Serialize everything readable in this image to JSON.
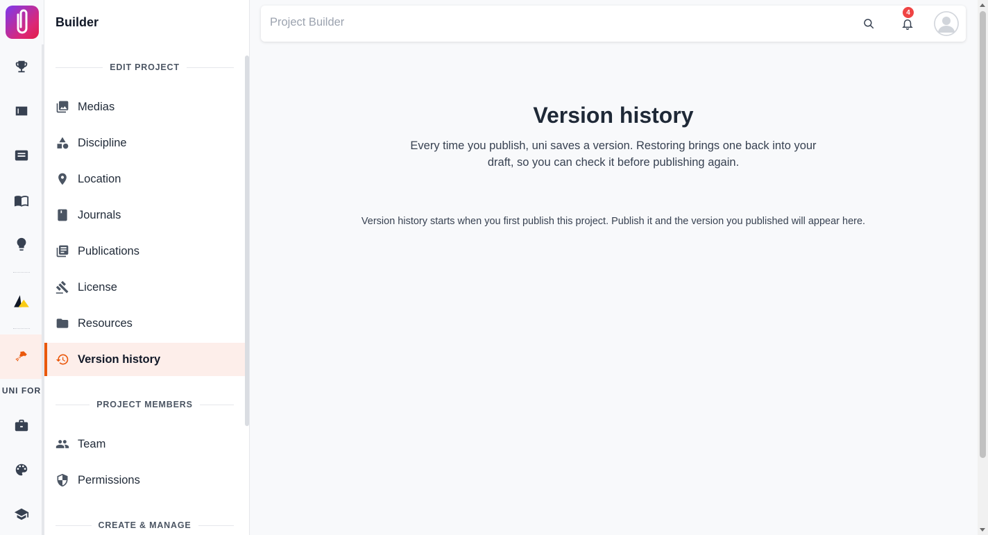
{
  "app": {
    "brand_color": "#db2777",
    "accent": "#ea580c"
  },
  "rail": {
    "items": [
      {
        "name": "trophy-icon"
      },
      {
        "name": "hashtag-card-icon"
      },
      {
        "name": "article-icon"
      },
      {
        "name": "book-icon"
      },
      {
        "name": "lightbulb-icon"
      },
      {
        "name": "shapes-icon"
      },
      {
        "name": "pen-tool-icon",
        "active": true
      },
      {
        "name": "briefcase-icon"
      },
      {
        "name": "palette-icon"
      },
      {
        "name": "graduation-cap-icon"
      }
    ],
    "section_label": "UNI FOR"
  },
  "sidebar": {
    "title": "Builder",
    "section_edit": "EDIT PROJECT",
    "section_members": "PROJECT MEMBERS",
    "section_create": "CREATE & MANAGE",
    "items": [
      {
        "label": "Medias",
        "icon": "images-icon"
      },
      {
        "label": "Discipline",
        "icon": "category-icon"
      },
      {
        "label": "Location",
        "icon": "pin-icon"
      },
      {
        "label": "Journals",
        "icon": "journal-icon"
      },
      {
        "label": "Publications",
        "icon": "library-icon"
      },
      {
        "label": "License",
        "icon": "gavel-icon"
      },
      {
        "label": "Resources",
        "icon": "folder-icon"
      },
      {
        "label": "Version history",
        "icon": "history-icon",
        "active": true
      }
    ],
    "member_items": [
      {
        "label": "Team",
        "icon": "people-icon"
      },
      {
        "label": "Permissions",
        "icon": "shield-icon"
      }
    ]
  },
  "topbar": {
    "title": "Project Builder",
    "notification_count": "4"
  },
  "main": {
    "title": "Version history",
    "description": "Every time you publish, uni saves a version. Restoring brings one back into your draft, so you can check it before publishing again.",
    "empty_message": "Version history starts when you first publish this project. Publish it and the version you published will appear here."
  }
}
